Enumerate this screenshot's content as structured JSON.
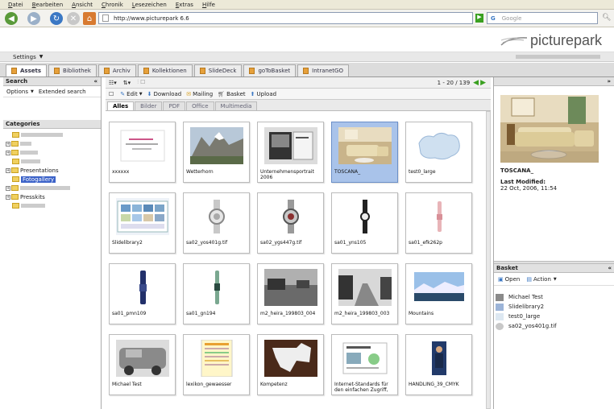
{
  "browser": {
    "menu": [
      "Datei",
      "Bearbeiten",
      "Ansicht",
      "Chronik",
      "Lesezeichen",
      "Extras",
      "Hilfe"
    ],
    "url": "http://www.picturepark 6.6",
    "search_placeholder": "Google"
  },
  "app": {
    "logo_text": "picturepark",
    "settings_label": "Settings",
    "tabs": [
      "Assets",
      "Bibliothek",
      "Archiv",
      "Kollektionen",
      "SlideDeck",
      "goToBasket",
      "IntranetGO"
    ]
  },
  "left": {
    "search_title": "Search",
    "options_label": "Options",
    "extended_search_label": "Extended search",
    "categories_title": "Categories",
    "tree": [
      {
        "label": "Presentations"
      },
      {
        "label": "Fotogallery"
      },
      {
        "label": "Presskits"
      }
    ]
  },
  "main": {
    "pagination": "1 - 20 / 139",
    "actions": [
      "Edit",
      "Download",
      "Mailing",
      "Basket",
      "Upload"
    ],
    "filter_tabs": [
      "Alles",
      "Bilder",
      "PDF",
      "Office",
      "Multimedia"
    ],
    "assets": [
      {
        "caption": "xxxxxx",
        "thumb": "doc"
      },
      {
        "caption": "Wetterhorn",
        "thumb": "mountain"
      },
      {
        "caption": "Unternehmensportrait 2006",
        "thumb": "brochure"
      },
      {
        "caption": "TOSCANA_",
        "thumb": "sofa",
        "selected": true
      },
      {
        "caption": "test0_large",
        "thumb": "map"
      },
      {
        "caption": "Slidelibrary2",
        "thumb": "screen"
      },
      {
        "caption": "sa02_yos401g.tif",
        "thumb": "watch-silver"
      },
      {
        "caption": "sa02_ygs447g.tif",
        "thumb": "watch-dark"
      },
      {
        "caption": "sa01_yns105",
        "thumb": "watch-black"
      },
      {
        "caption": "sa01_efk262p",
        "thumb": "watch-pink"
      },
      {
        "caption": "sa01_pmn109",
        "thumb": "watch-blue"
      },
      {
        "caption": "sa01_gn194",
        "thumb": "watch-green"
      },
      {
        "caption": "m2_heira_199803_004",
        "thumb": "bw-road"
      },
      {
        "caption": "m2_heira_199803_003",
        "thumb": "bw-road2"
      },
      {
        "caption": "Mountains",
        "thumb": "landscape"
      },
      {
        "caption": "Michael Test",
        "thumb": "car"
      },
      {
        "caption": "lexikon_gewaesser",
        "thumb": "chart-doc"
      },
      {
        "caption": "Kompetenz",
        "thumb": "wood"
      },
      {
        "caption": "Internet-Standards für den einfachen Zugriff,",
        "thumb": "slide"
      },
      {
        "caption": "HANDLING_39_CMYK",
        "thumb": "person"
      }
    ]
  },
  "detail": {
    "title": "TOSCANA_",
    "modified_label": "Last Modified:",
    "modified_value": "22 Oct, 2006, 11:54"
  },
  "basket": {
    "title": "Basket",
    "open_label": "Open",
    "action_label": "Action",
    "items": [
      "Michael Test",
      "Slidelibrary2",
      "test0_large",
      "sa02_yos401g.tif"
    ]
  },
  "colors": {
    "selection": "#a9c3ea",
    "accent_green": "#3aa020"
  }
}
